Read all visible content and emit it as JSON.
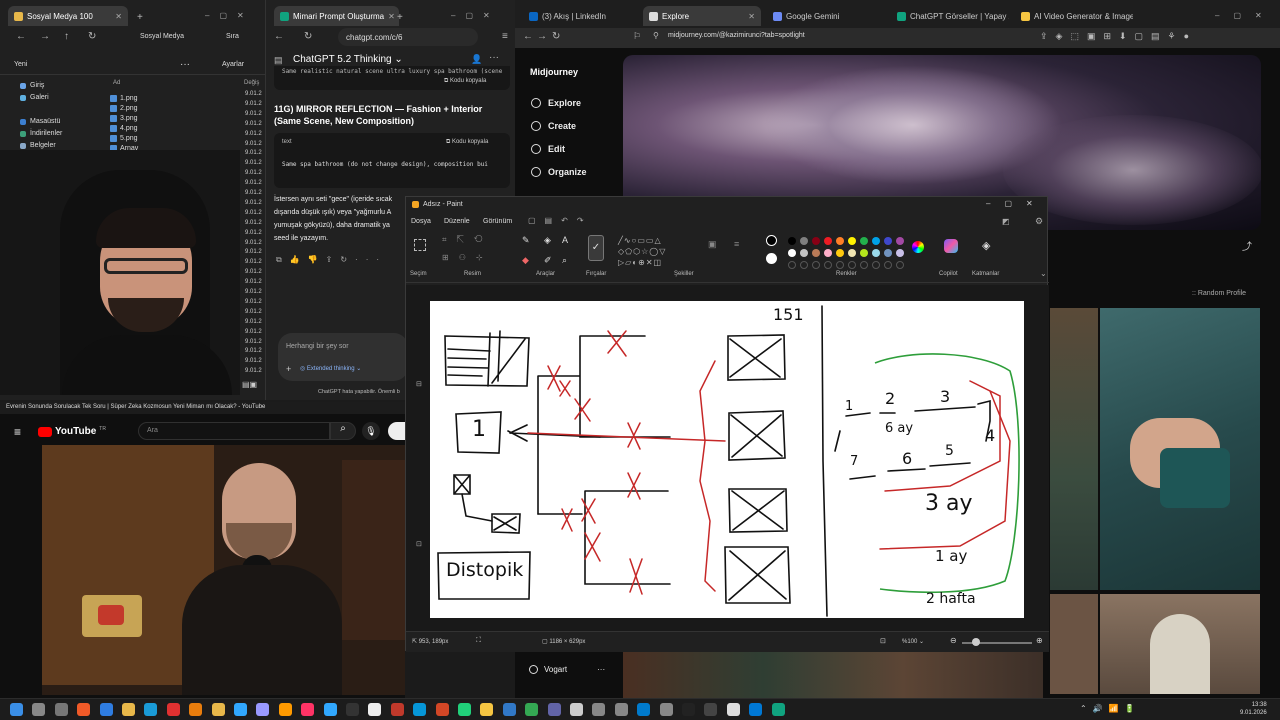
{
  "left_browser": {
    "tabs": [
      {
        "label": "Sosyal Medya 100"
      }
    ],
    "toolbar": {
      "profile": "Sosyal Medya",
      "save": "Sıra"
    },
    "explorer": {
      "new_label": "Yeni",
      "sort_label": "Ayarlar",
      "col_name": "Ad",
      "col_date": "Değiş",
      "sidebar": [
        {
          "label": "Giriş",
          "icon": "home-icon"
        },
        {
          "label": "Galeri",
          "icon": "gallery-icon"
        },
        {
          "label": "Masaüstü",
          "icon": "desktop-icon"
        },
        {
          "label": "İndirilenler",
          "icon": "download-icon"
        },
        {
          "label": "Belgeler",
          "icon": "documents-icon"
        }
      ],
      "files": [
        "1.png",
        "2.png",
        "3.png",
        "4.png",
        "5.png",
        "Arnav"
      ],
      "dates": [
        "9.01.2",
        "9.01.2",
        "9.01.2",
        "9.01.2",
        "9.01.2",
        "9.01.2",
        "9.01.2",
        "9.01.2",
        "9.01.2",
        "9.01.2",
        "9.01.2",
        "9.01.2",
        "9.01.2",
        "9.01.2",
        "9.01.2",
        "9.01.2",
        "9.01.2",
        "9.01.2",
        "9.01.2",
        "9.01.2",
        "9.01.2",
        "9.01.2",
        "9.01.2",
        "9.01.2",
        "9.01.2",
        "9.01.2",
        "9.01.2",
        "9.01.2",
        "9.01.2"
      ]
    }
  },
  "chatgpt": {
    "tab": "Mimari Prompt Oluşturma",
    "url": "chatgpt.com/c/6",
    "model": "ChatGPT 5.2 Thinking",
    "truncated_top": "Same realistic natural scene ultra luxury spa bathroom (scene",
    "copy_label": "Kodu kopyala",
    "heading": "11G) MIRROR REFLECTION — Fashion + Interior (Same Scene, New Composition)",
    "code_lang": "text",
    "code_text": "Same spa bathroom (do not change design), composition bui",
    "paragraph_1": "İstersen aynı seti \"gece\" (içeride sıcak",
    "paragraph_2": "dışarıda düşük ışık) veya \"yağmurlu A",
    "paragraph_3": "yumuşak gökyüzü), daha dramatik ya",
    "paragraph_4": "seed ile yazayım.",
    "input_placeholder": "Herhangi bir şey sor",
    "extended_thinking": "Extended thinking",
    "footer": "ChatGPT hata yapabilir. Önemli b"
  },
  "youtube": {
    "title": "Evrenin Sonunda Sorulacak Tek Soru | Süper Zeka Kozmosun Yeni Mimarı mı Olacak? - YouTube",
    "brand": "YouTube",
    "region": "TR",
    "search_placeholder": "Ara"
  },
  "midjourney": {
    "tabs": [
      {
        "label": "(3) Akış | LinkedIn"
      },
      {
        "label": "Explore"
      },
      {
        "label": "Google Gemini"
      },
      {
        "label": "ChatGPT Görseller | Yapay Zekalı Gö"
      },
      {
        "label": "AI Video Generator & Image Generat"
      }
    ],
    "url": "midjourney.com/@kazimirunci?tab=spotlight",
    "brand": "Midjourney",
    "nav": [
      "Explore",
      "Create",
      "Edit",
      "Organize"
    ],
    "random_profile": ":: Random Profile",
    "user": "Vogart"
  },
  "paint": {
    "title": "Adsız - Paint",
    "menu": [
      "Dosya",
      "Düzenle",
      "Görünüm"
    ],
    "groups": [
      "Seçim",
      "Resim",
      "Araçlar",
      "Fırçalar",
      "Şekiller",
      "Renkler",
      "Copilot",
      "Katmanlar"
    ],
    "status_pos": "953, 189px",
    "status_size": "1186 × 629px",
    "zoom": "%100",
    "palette": [
      "#000000",
      "#7f7f7f",
      "#880015",
      "#ed1c24",
      "#ff7f27",
      "#fff200",
      "#22b14c",
      "#00a2e8",
      "#3f48cc",
      "#a349a4",
      "#ffffff",
      "#c3c3c3",
      "#b97a57",
      "#ffaec9",
      "#ffc90e",
      "#efe4b0",
      "#b5e61d",
      "#99d9ea",
      "#7092be",
      "#c8bfe7"
    ],
    "canvas": {
      "num_151": "151",
      "box_1": "1",
      "distopik": "Distopik",
      "steps": [
        "1",
        "2",
        "3",
        "4",
        "5",
        "6",
        "7"
      ],
      "6_ay": "6 ay",
      "3_ay": "3 ay",
      "1_ay": "1 ay",
      "2_hafta": "2 hafta"
    }
  },
  "taskbar": {
    "time": "13:38",
    "date": "9.01.2026"
  }
}
